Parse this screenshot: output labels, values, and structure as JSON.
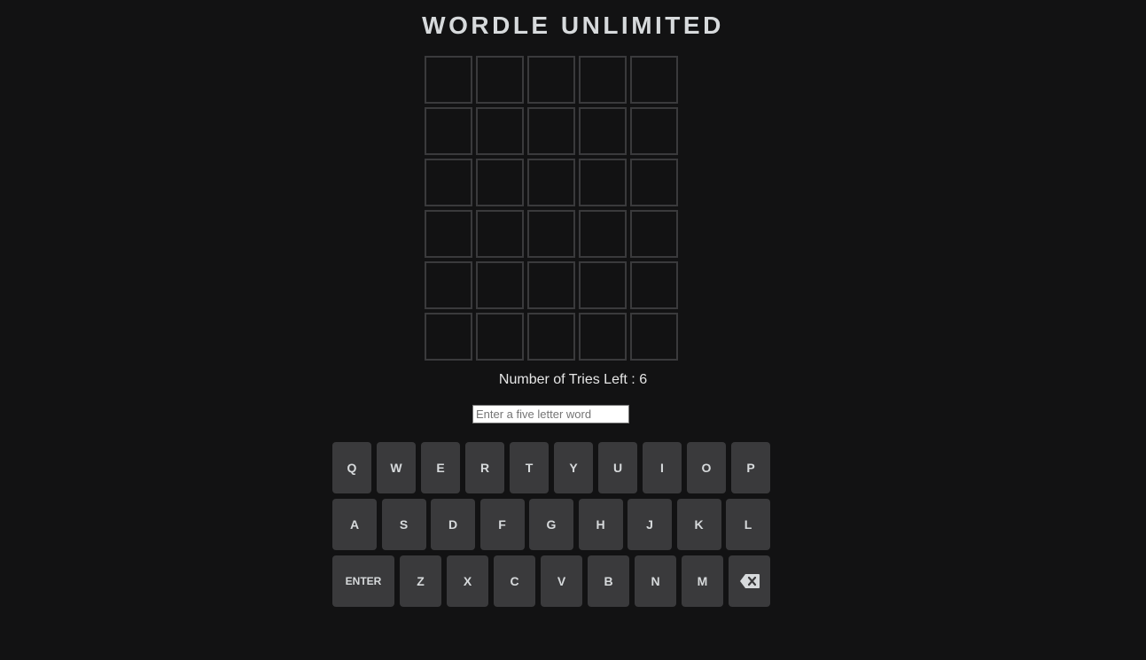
{
  "title": "WORDLE UNLIMITED",
  "board": {
    "rows": [
      [
        "",
        "",
        "",
        "",
        ""
      ],
      [
        "",
        "",
        "",
        "",
        ""
      ],
      [
        "",
        "",
        "",
        "",
        ""
      ],
      [
        "",
        "",
        "",
        "",
        ""
      ],
      [
        "",
        "",
        "",
        "",
        ""
      ],
      [
        "",
        "",
        "",
        "",
        ""
      ]
    ]
  },
  "status": {
    "tries_label": "Number of Tries Left : 6"
  },
  "input": {
    "placeholder": "Enter a five letter word",
    "value": ""
  },
  "keyboard": {
    "row1": [
      "Q",
      "W",
      "E",
      "R",
      "T",
      "Y",
      "U",
      "I",
      "O",
      "P"
    ],
    "row2": [
      "A",
      "S",
      "D",
      "F",
      "G",
      "H",
      "J",
      "K",
      "L"
    ],
    "row3": [
      "Z",
      "X",
      "C",
      "V",
      "B",
      "N",
      "M"
    ],
    "enter_label": "ENTER",
    "backspace_icon": "backspace-icon"
  },
  "colors": {
    "background": "#121213",
    "tile_border": "#3a3a3c",
    "key_background": "#3a3a3c",
    "text": "#d7dadc"
  }
}
